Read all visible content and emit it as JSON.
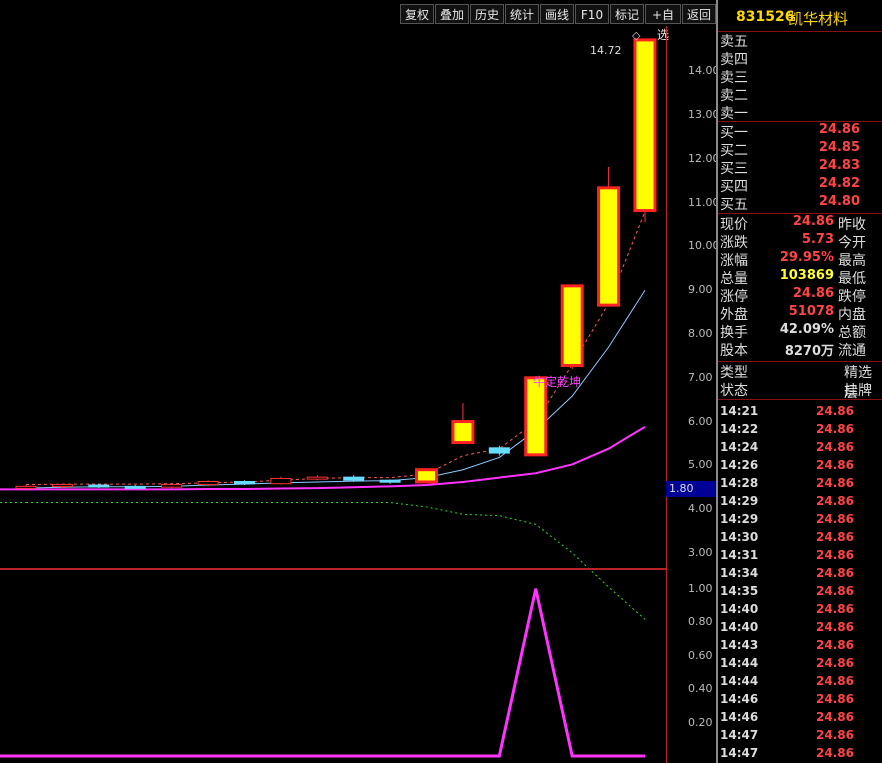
{
  "toolbar": {
    "buttons": [
      "复权",
      "叠加",
      "历史",
      "统计",
      "画线",
      "F10",
      "标记",
      "+自选",
      "返回"
    ]
  },
  "chart": {
    "price_labels": [
      "14.00",
      "13.00",
      "12.00",
      "11.00",
      "10.00",
      "9.00",
      "8.00",
      "7.00",
      "6.00",
      "5.00",
      "4.00",
      "3.00"
    ],
    "indicator_labels": [
      "1.00",
      "0.80",
      "0.60",
      "0.40",
      "0.20"
    ],
    "high_label": "14.72",
    "flag_value": "1.80",
    "annotation": "牛定乾坤"
  },
  "chart_data": {
    "type": "candlestick",
    "price_axis": [
      2.7,
      14.9
    ],
    "candles": [
      {
        "open": 4.48,
        "close": 4.52,
        "high": 4.56,
        "low": 4.45
      },
      {
        "open": 4.52,
        "close": 4.56,
        "high": 4.58,
        "low": 4.48
      },
      {
        "open": 4.55,
        "close": 4.52,
        "high": 4.58,
        "low": 4.48
      },
      {
        "open": 4.52,
        "close": 4.5,
        "high": 4.55,
        "low": 4.46
      },
      {
        "open": 4.5,
        "close": 4.56,
        "high": 4.6,
        "low": 4.47
      },
      {
        "open": 4.56,
        "close": 4.63,
        "high": 4.66,
        "low": 4.52
      },
      {
        "open": 4.63,
        "close": 4.58,
        "high": 4.66,
        "low": 4.55
      },
      {
        "open": 4.58,
        "close": 4.7,
        "high": 4.74,
        "low": 4.56
      },
      {
        "open": 4.7,
        "close": 4.73,
        "high": 4.78,
        "low": 4.66
      },
      {
        "open": 4.73,
        "close": 4.66,
        "high": 4.78,
        "low": 4.62
      },
      {
        "open": 4.66,
        "close": 4.62,
        "high": 4.68,
        "low": 4.58
      },
      {
        "open": 4.62,
        "close": 4.9,
        "high": 4.92,
        "low": 4.6
      },
      {
        "open": 5.52,
        "close": 6.0,
        "high": 6.42,
        "low": 5.52
      },
      {
        "open": 5.4,
        "close": 5.28,
        "high": 5.45,
        "low": 5.22
      },
      {
        "open": 5.24,
        "close": 7.0,
        "high": 7.0,
        "low": 5.22
      },
      {
        "open": 7.28,
        "close": 9.1,
        "high": 9.1,
        "low": 7.2
      },
      {
        "open": 8.66,
        "close": 11.34,
        "high": 11.82,
        "low": 8.66
      },
      {
        "open": 10.82,
        "close": 14.72,
        "high": 14.72,
        "low": 10.55
      }
    ],
    "ma_pink": [
      4.45,
      4.45,
      4.45,
      4.45,
      4.45,
      4.46,
      4.46,
      4.47,
      4.48,
      4.5,
      4.52,
      4.55,
      4.62,
      4.72,
      4.82,
      5.02,
      5.38,
      5.88
    ],
    "ma_blue": [
      4.48,
      4.5,
      4.51,
      4.51,
      4.52,
      4.55,
      4.57,
      4.6,
      4.62,
      4.64,
      4.65,
      4.72,
      4.9,
      5.18,
      5.8,
      6.58,
      7.7,
      9.0
    ],
    "ma_red_dashed": [
      4.56,
      4.57,
      4.57,
      4.57,
      4.58,
      4.6,
      4.62,
      4.66,
      4.7,
      4.72,
      4.72,
      4.8,
      5.22,
      5.38,
      6.0,
      7.3,
      8.7,
      10.8
    ],
    "green_dotted": [
      4.15,
      4.15,
      4.15,
      4.15,
      4.15,
      4.15,
      4.15,
      4.15,
      4.15,
      4.15,
      4.15,
      4.05,
      3.88,
      3.85,
      3.65,
      3.0,
      2.22,
      1.48
    ],
    "indicator": {
      "range": [
        0,
        1.1
      ],
      "values": [
        0,
        0,
        0,
        0,
        0,
        0,
        0,
        0,
        0,
        0,
        0,
        0,
        0,
        0,
        1.0,
        0,
        0,
        0
      ]
    }
  },
  "panel": {
    "stock_code": "831526",
    "stock_name": "凯华材料",
    "asks": [
      {
        "label": "卖五",
        "price": ""
      },
      {
        "label": "卖四",
        "price": ""
      },
      {
        "label": "卖三",
        "price": ""
      },
      {
        "label": "卖二",
        "price": ""
      },
      {
        "label": "卖一",
        "price": ""
      }
    ],
    "bids": [
      {
        "label": "买一",
        "price": "24.86"
      },
      {
        "label": "买二",
        "price": "24.85"
      },
      {
        "label": "买三",
        "price": "24.83"
      },
      {
        "label": "买四",
        "price": "24.82"
      },
      {
        "label": "买五",
        "price": "24.80"
      }
    ],
    "stats": [
      {
        "label": "现价",
        "value": "24.86",
        "color": "#ff4444",
        "label2": "昨收"
      },
      {
        "label": "涨跌",
        "value": "5.73",
        "color": "#ff4444",
        "label2": "今开"
      },
      {
        "label": "涨幅",
        "value": "29.95%",
        "color": "#ff4444",
        "label2": "最高"
      },
      {
        "label": "总量",
        "value": "103869",
        "color": "#ffff33",
        "label2": "最低"
      },
      {
        "label": "涨停",
        "value": "24.86",
        "color": "#ff4444",
        "label2": "跌停"
      },
      {
        "label": "外盘",
        "value": "51078",
        "color": "#ff4444",
        "label2": "内盘"
      },
      {
        "label": "换手",
        "value": "42.09%",
        "color": "#dddddd",
        "label2": "总额"
      },
      {
        "label": "股本",
        "value": "8270万",
        "color": "#dddddd",
        "label2": "流通"
      }
    ],
    "type_label": "类型",
    "type_value": "精选层",
    "status_label": "状态",
    "status_value": "挂牌",
    "ticks": [
      {
        "time": "14:21",
        "price": "24.86"
      },
      {
        "time": "14:22",
        "price": "24.86"
      },
      {
        "time": "14:24",
        "price": "24.86"
      },
      {
        "time": "14:26",
        "price": "24.86"
      },
      {
        "time": "14:28",
        "price": "24.86"
      },
      {
        "time": "14:29",
        "price": "24.86"
      },
      {
        "time": "14:29",
        "price": "24.86"
      },
      {
        "time": "14:30",
        "price": "24.86"
      },
      {
        "time": "14:31",
        "price": "24.86"
      },
      {
        "time": "14:34",
        "price": "24.86"
      },
      {
        "time": "14:35",
        "price": "24.86"
      },
      {
        "time": "14:40",
        "price": "24.86"
      },
      {
        "time": "14:40",
        "price": "24.86"
      },
      {
        "time": "14:43",
        "price": "24.86"
      },
      {
        "time": "14:44",
        "price": "24.86"
      },
      {
        "time": "14:44",
        "price": "24.86"
      },
      {
        "time": "14:46",
        "price": "24.86"
      },
      {
        "time": "14:46",
        "price": "24.86"
      },
      {
        "time": "14:47",
        "price": "24.86"
      },
      {
        "time": "14:47",
        "price": "24.86"
      }
    ]
  }
}
